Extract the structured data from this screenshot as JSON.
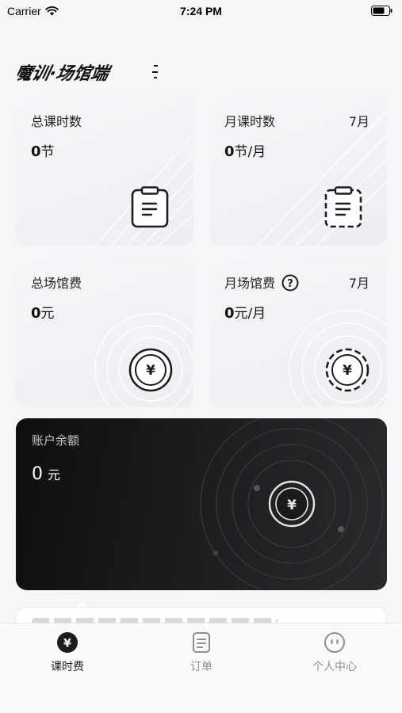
{
  "status_bar": {
    "carrier": "Carrier",
    "time": "7:24 PM"
  },
  "brand": {
    "logo_text": "魔训·场馆端"
  },
  "cards": {
    "total_lessons": {
      "title": "总课时数",
      "value": "0",
      "unit": "节"
    },
    "monthly_lessons": {
      "title": "月课时数",
      "month": "7月",
      "value": "0",
      "unit": "节/月"
    },
    "total_venue_fee": {
      "title": "总场馆费",
      "value": "0",
      "unit": "元"
    },
    "monthly_venue_fee": {
      "title": "月场馆费",
      "month": "7月",
      "value": "0",
      "unit": "元/月"
    }
  },
  "balance": {
    "label": "账户余额",
    "value": "0",
    "unit": "元"
  },
  "tabs": [
    {
      "label": "课时费",
      "icon": "yen-circle-icon",
      "active": true
    },
    {
      "label": "订单",
      "icon": "document-icon",
      "active": false
    },
    {
      "label": "个人中心",
      "icon": "face-icon",
      "active": false
    }
  ],
  "colors": {
    "accent": "#1c1c1e",
    "inactive": "#8e8e93",
    "balance_bg": "#161618"
  }
}
